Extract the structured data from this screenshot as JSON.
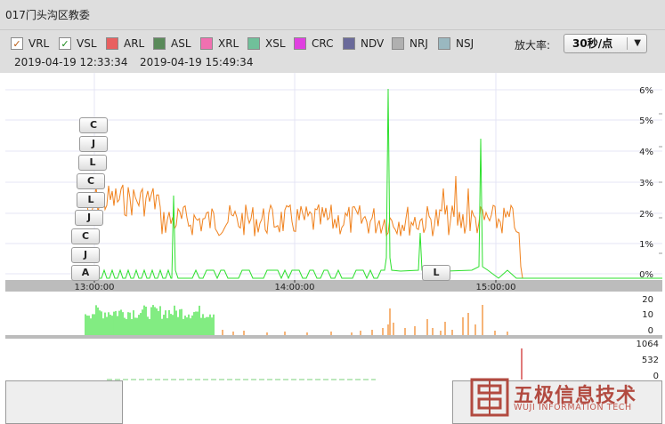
{
  "title": "017门头沟区教委",
  "legend": [
    {
      "key": "VRL",
      "color": "#f08a2a",
      "checked": true,
      "check_color": "#b85a10"
    },
    {
      "key": "VSL",
      "color": "#9af09a",
      "checked": true,
      "check_color": "#1a8a1a"
    },
    {
      "key": "ARL",
      "color": "#e86060",
      "checked": false
    },
    {
      "key": "ASL",
      "color": "#5a8a5a",
      "checked": false
    },
    {
      "key": "XRL",
      "color": "#f070b0",
      "checked": false
    },
    {
      "key": "XSL",
      "color": "#70c09a",
      "checked": false
    },
    {
      "key": "CRC",
      "color": "#e040e0",
      "checked": false
    },
    {
      "key": "NDV",
      "color": "#6a6a9a",
      "checked": false
    },
    {
      "key": "NRJ",
      "color": "#b0b0b0",
      "checked": false
    },
    {
      "key": "NSJ",
      "color": "#9ab8c0",
      "checked": false
    }
  ],
  "time_start": "2019-04-19 12:33:34",
  "time_end": "2019-04-19 15:49:34",
  "zoom_label": "放大率:",
  "zoom_value": "30秒/点",
  "main_y_ticks": [
    "6%",
    "5%",
    "4%",
    "3%",
    "2%",
    "1%",
    "0%"
  ],
  "x_ticks": [
    "13:00:00",
    "14:00:00",
    "15:00:00"
  ],
  "mid_y_ticks": [
    "20",
    "10",
    "0"
  ],
  "low_y_ticks": [
    "1064",
    "532",
    "0"
  ],
  "annotations": [
    "C",
    "J",
    "L",
    "C",
    "L",
    "J",
    "C",
    "J",
    "A",
    "L"
  ],
  "logo": {
    "cn": "五极信息技术",
    "en": "WUJI INFORMATION TECH"
  }
}
